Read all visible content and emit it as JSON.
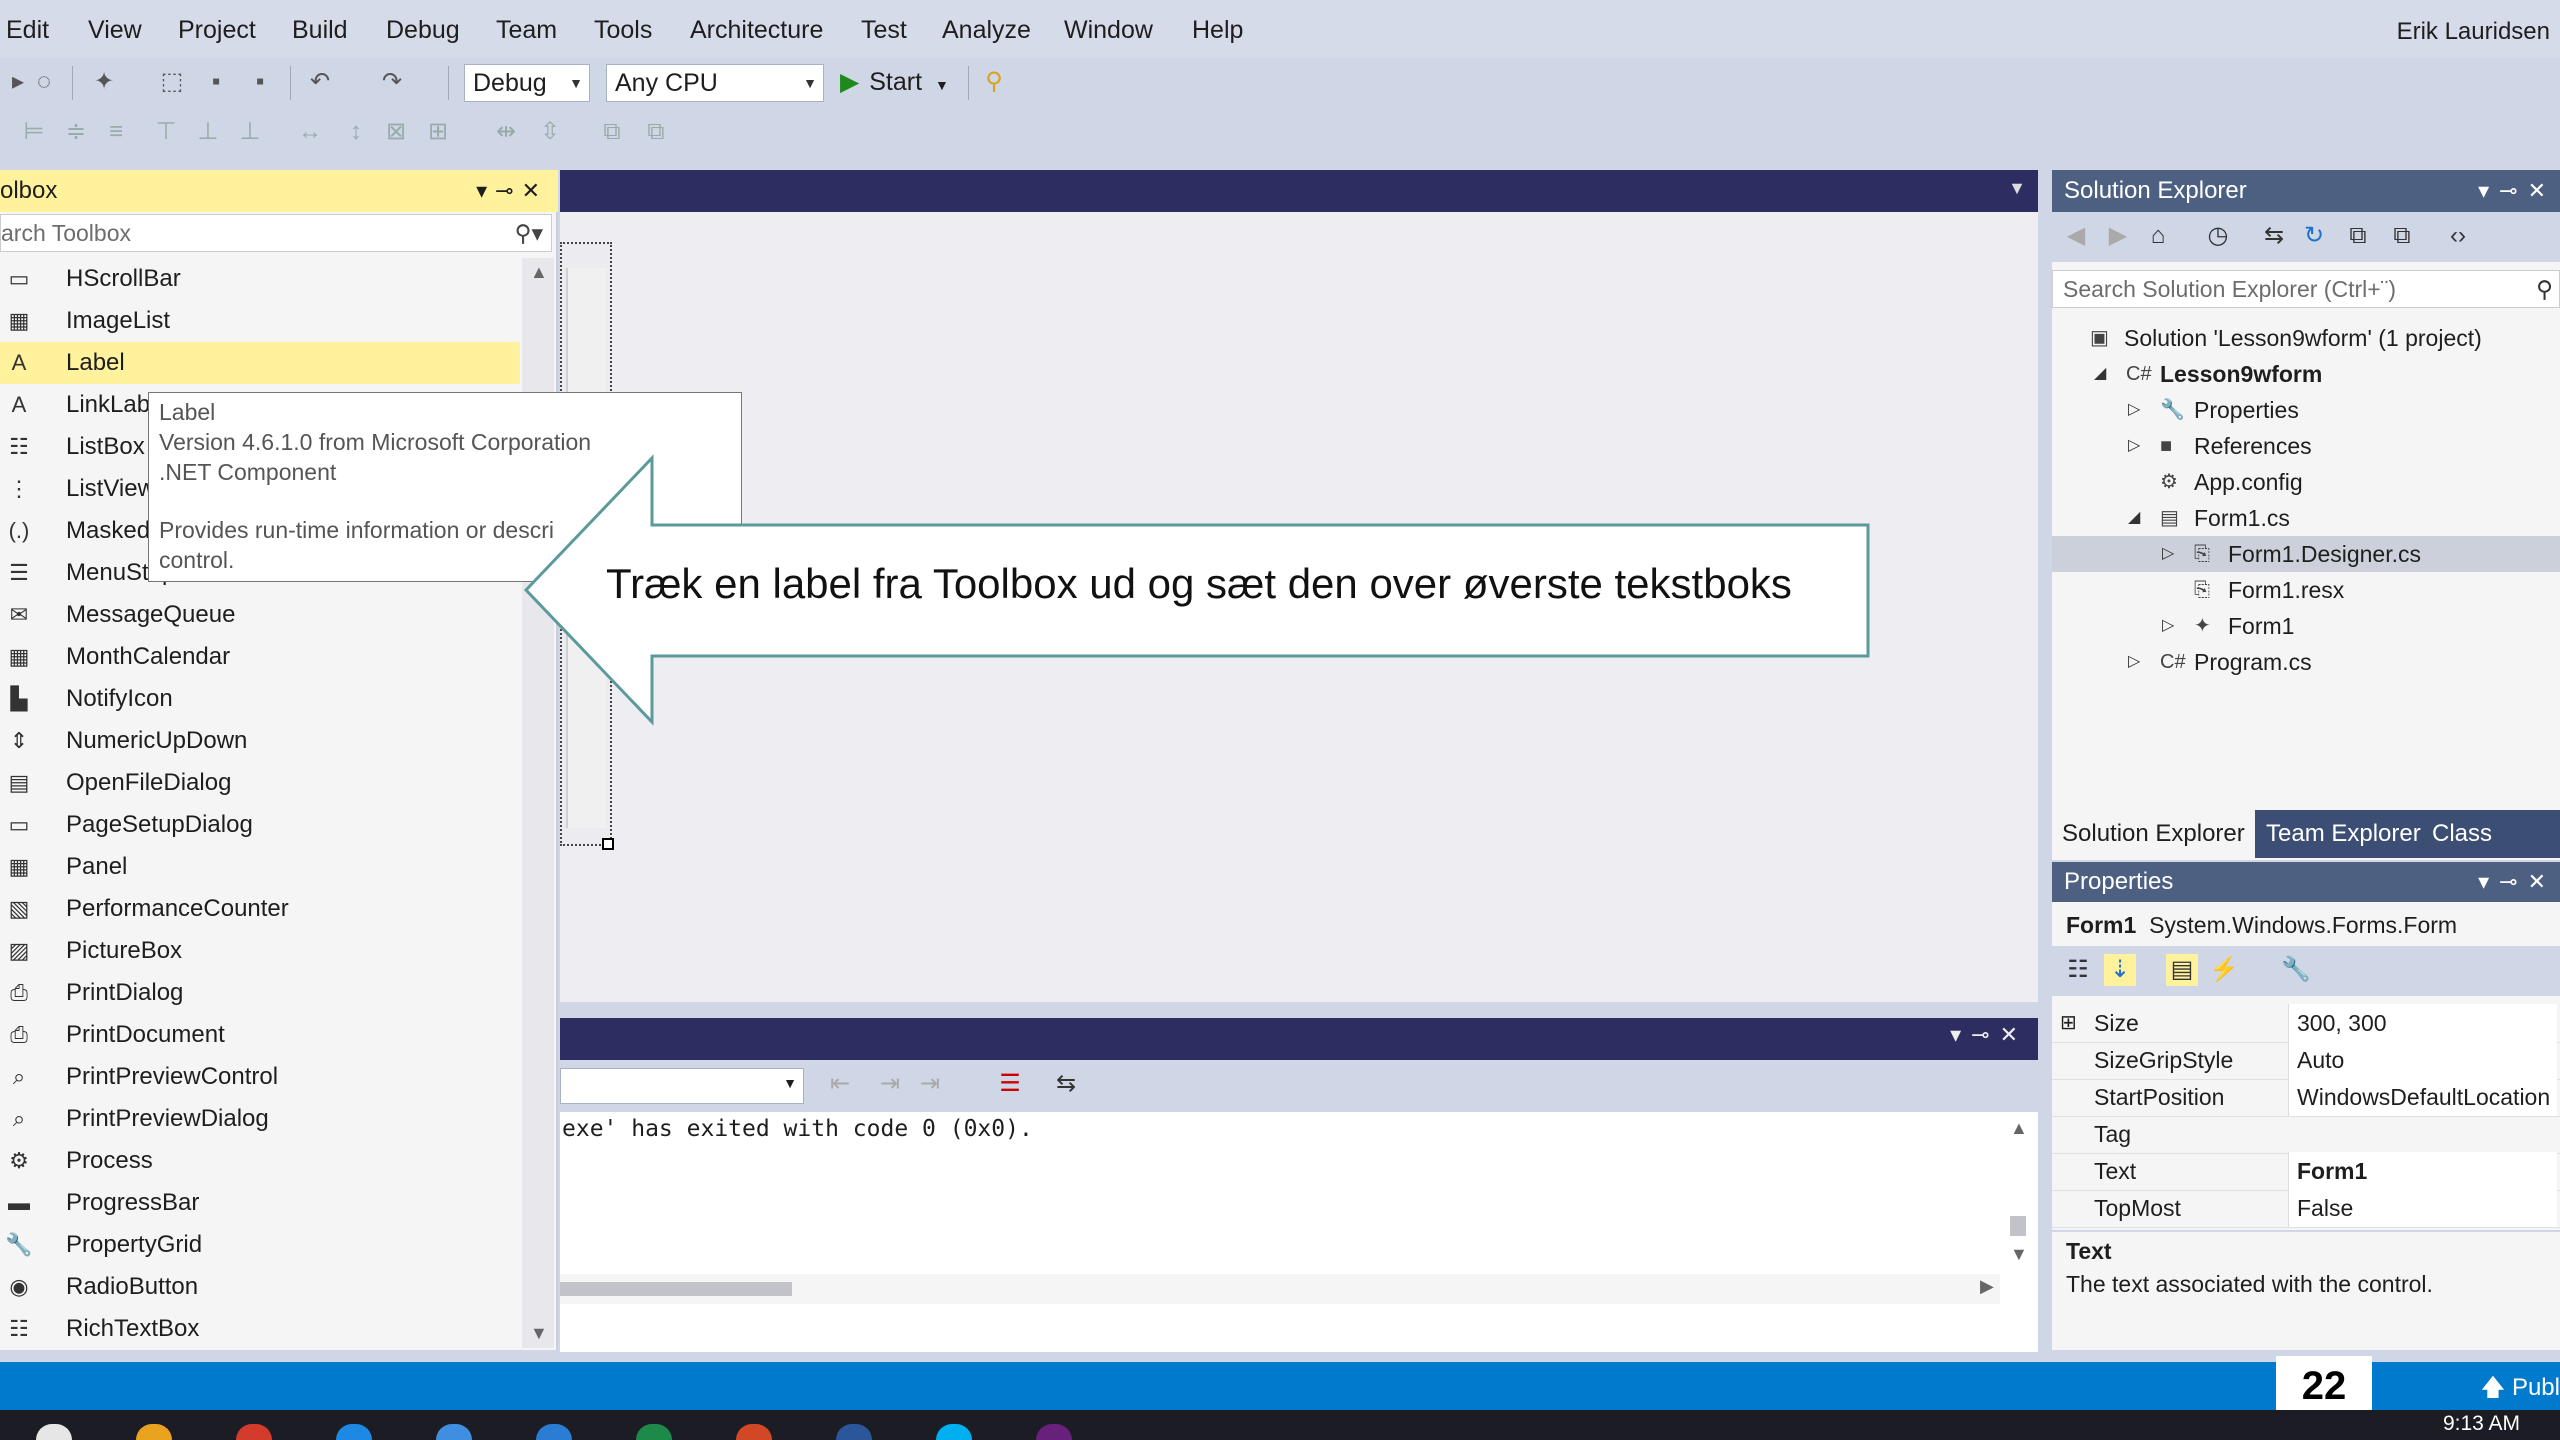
{
  "menu": {
    "items": [
      "Edit",
      "View",
      "Project",
      "Build",
      "Debug",
      "Team",
      "Tools",
      "Architecture",
      "Test",
      "Analyze",
      "Window",
      "Help"
    ],
    "user": "Erik Lauridsen"
  },
  "toolbar": {
    "config": "Debug",
    "platform": "Any CPU",
    "start_label": "Start"
  },
  "toolbox": {
    "title": "olbox",
    "search_placeholder": "arch Toolbox",
    "items": [
      {
        "label": "HScrollBar",
        "icon": "hscrollbar-icon",
        "glyph": "▭"
      },
      {
        "label": "ImageList",
        "icon": "imagelist-icon",
        "glyph": "▦"
      },
      {
        "label": "Label",
        "icon": "label-icon",
        "glyph": "A",
        "selected": true
      },
      {
        "label": "LinkLabel",
        "icon": "linklabel-icon",
        "glyph": "A"
      },
      {
        "label": "ListBox",
        "icon": "listbox-icon",
        "glyph": "☷"
      },
      {
        "label": "ListView",
        "icon": "listview-icon",
        "glyph": "⋮"
      },
      {
        "label": "MaskedTextBox",
        "icon": "maskedtextbox-icon",
        "glyph": "(.)"
      },
      {
        "label": "MenuStrip",
        "icon": "menustrip-icon",
        "glyph": "☰"
      },
      {
        "label": "MessageQueue",
        "icon": "messagequeue-icon",
        "glyph": "✉"
      },
      {
        "label": "MonthCalendar",
        "icon": "monthcalendar-icon",
        "glyph": "▦"
      },
      {
        "label": "NotifyIcon",
        "icon": "notifyicon-icon",
        "glyph": "▙"
      },
      {
        "label": "NumericUpDown",
        "icon": "numericupdown-icon",
        "glyph": "⇕"
      },
      {
        "label": "OpenFileDialog",
        "icon": "openfiledialog-icon",
        "glyph": "▤"
      },
      {
        "label": "PageSetupDialog",
        "icon": "pagesetupdialog-icon",
        "glyph": "▭"
      },
      {
        "label": "Panel",
        "icon": "panel-icon",
        "glyph": "▦"
      },
      {
        "label": "PerformanceCounter",
        "icon": "performancecounter-icon",
        "glyph": "▧"
      },
      {
        "label": "PictureBox",
        "icon": "picturebox-icon",
        "glyph": "▨"
      },
      {
        "label": "PrintDialog",
        "icon": "printdialog-icon",
        "glyph": "⎙"
      },
      {
        "label": "PrintDocument",
        "icon": "printdocument-icon",
        "glyph": "⎙"
      },
      {
        "label": "PrintPreviewControl",
        "icon": "printpreviewcontrol-icon",
        "glyph": "⌕"
      },
      {
        "label": "PrintPreviewDialog",
        "icon": "printpreviewdialog-icon",
        "glyph": "⌕"
      },
      {
        "label": "Process",
        "icon": "process-icon",
        "glyph": "⚙"
      },
      {
        "label": "ProgressBar",
        "icon": "progressbar-icon",
        "glyph": "▬"
      },
      {
        "label": "PropertyGrid",
        "icon": "propertygrid-icon",
        "glyph": "🔧"
      },
      {
        "label": "RadioButton",
        "icon": "radiobutton-icon",
        "glyph": "◉"
      },
      {
        "label": "RichTextBox",
        "icon": "richtextbox-icon",
        "glyph": "☷"
      }
    ]
  },
  "tooltip": {
    "name": "Label",
    "version": "Version 4.6.1.0 from Microsoft Corporation",
    "component": ".NET Component",
    "desc1": "Provides run-time information or descri",
    "desc2": "control."
  },
  "callout": {
    "text": "Træk en label fra Toolbox ud og sæt den over øverste tekstboks"
  },
  "output": {
    "line": "exe' has exited with code 0 (0x0)."
  },
  "solution_explorer": {
    "title": "Solution Explorer",
    "search_placeholder": "Search Solution Explorer (Ctrl+¨)",
    "tree": [
      {
        "label": "Solution 'Lesson9wform' (1 project)",
        "icon": "solution-icon",
        "glyph": "▣",
        "depth": 0,
        "expander": ""
      },
      {
        "label": "Lesson9wform",
        "icon": "csharp-project-icon",
        "glyph": "C#",
        "depth": 1,
        "expander": "◢",
        "bold": true
      },
      {
        "label": "Properties",
        "icon": "wrench-icon",
        "glyph": "🔧",
        "depth": 2,
        "expander": "▷"
      },
      {
        "label": "References",
        "icon": "references-icon",
        "glyph": "■",
        "depth": 2,
        "expander": "▷"
      },
      {
        "label": "App.config",
        "icon": "config-icon",
        "glyph": "⚙",
        "depth": 2,
        "expander": ""
      },
      {
        "label": "Form1.cs",
        "icon": "form-icon",
        "glyph": "▤",
        "depth": 2,
        "expander": "◢"
      },
      {
        "label": "Form1.Designer.cs",
        "icon": "code-file-icon",
        "glyph": "⎘",
        "depth": 3,
        "expander": "▷",
        "selected": true
      },
      {
        "label": "Form1.resx",
        "icon": "resx-icon",
        "glyph": "⎘",
        "depth": 3,
        "expander": ""
      },
      {
        "label": "Form1",
        "icon": "class-icon",
        "glyph": "✦",
        "depth": 3,
        "expander": "▷"
      },
      {
        "label": "Program.cs",
        "icon": "csharp-file-icon",
        "glyph": "C#",
        "depth": 2,
        "expander": "▷"
      }
    ],
    "tabs": [
      "Solution Explorer",
      "Team Explorer",
      "Class View"
    ]
  },
  "properties": {
    "title": "Properties",
    "object_name": "Form1",
    "object_type": "System.Windows.Forms.Form",
    "rows": [
      {
        "name": "Size",
        "value": "300, 300",
        "expander": "⊞"
      },
      {
        "name": "SizeGripStyle",
        "value": "Auto"
      },
      {
        "name": "StartPosition",
        "value": "WindowsDefaultLocation"
      },
      {
        "name": "Tag",
        "value": ""
      },
      {
        "name": "Text",
        "value": "Form1",
        "bold": true
      },
      {
        "name": "TopMost",
        "value": "False"
      }
    ],
    "desc_title": "Text",
    "desc_text": "The text associated with the control."
  },
  "statusbar": {
    "publish": "Publ",
    "page_number": "22"
  },
  "taskbar": {
    "time": "9:13 AM",
    "app_colors": [
      "#e6e6e6",
      "#e9a31e",
      "#d33b2c",
      "#1e88e5",
      "#3f8ee0",
      "#2b7cd3",
      "#1e8a4a",
      "#d24726",
      "#2b579a",
      "#00aff0",
      "#68217a"
    ]
  },
  "colors": {
    "accent": "#007acc",
    "selection": "#fff29d",
    "panel_header": "#4d6082",
    "callout_border": "#5b9a9c"
  }
}
